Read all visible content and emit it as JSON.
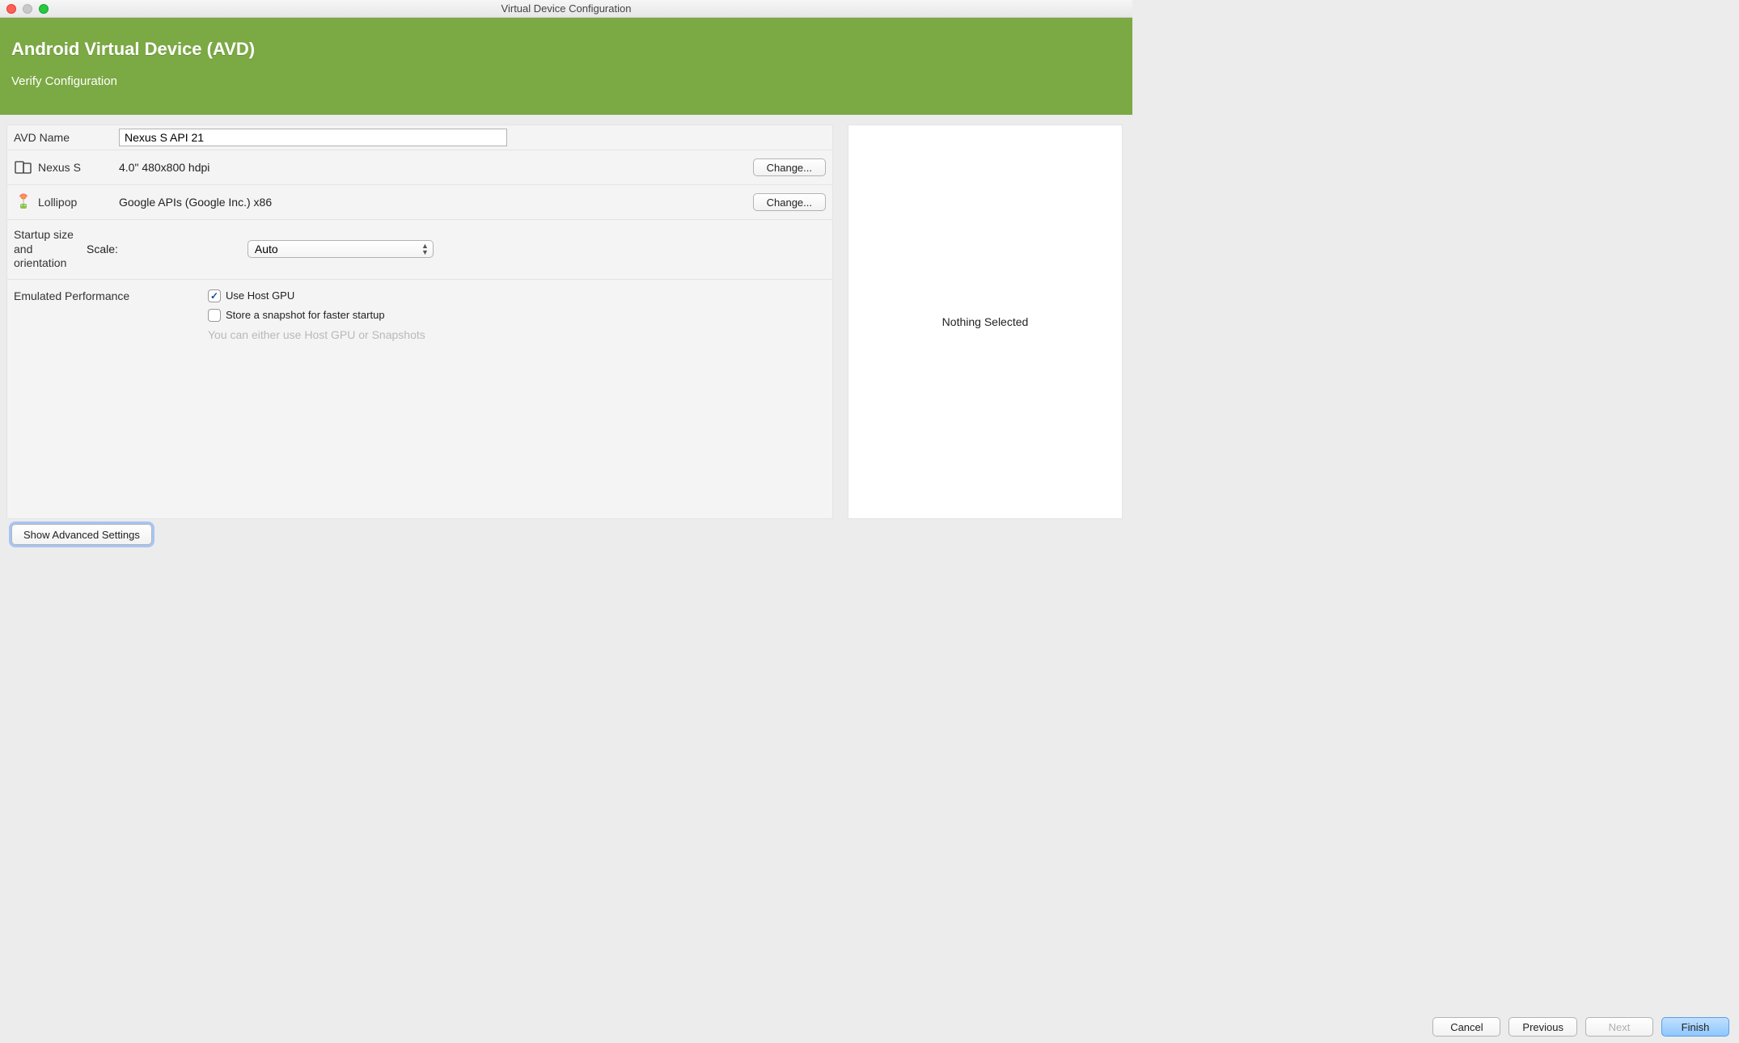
{
  "window": {
    "title": "Virtual Device Configuration"
  },
  "header": {
    "title": "Android Virtual Device (AVD)",
    "subtitle": "Verify Configuration"
  },
  "form": {
    "avd_name_label": "AVD Name",
    "avd_name_value": "Nexus S API 21",
    "device_name": "Nexus S",
    "device_spec": "4.0\" 480x800 hdpi",
    "device_change": "Change...",
    "system_name": "Lollipop",
    "system_spec": "Google APIs (Google Inc.) x86",
    "system_change": "Change...",
    "startup_label": "Startup size and orientation",
    "scale_label": "Scale:",
    "scale_value": "Auto",
    "perf_label": "Emulated Performance",
    "use_host_gpu": {
      "label": "Use Host GPU",
      "checked": true
    },
    "snapshot": {
      "label": "Store a snapshot for faster startup",
      "checked": false
    },
    "perf_hint": "You can either use Host GPU or Snapshots"
  },
  "right": {
    "placeholder": "Nothing Selected"
  },
  "advanced_btn": "Show Advanced Settings",
  "footer": {
    "cancel": "Cancel",
    "previous": "Previous",
    "next": "Next",
    "finish": "Finish"
  }
}
